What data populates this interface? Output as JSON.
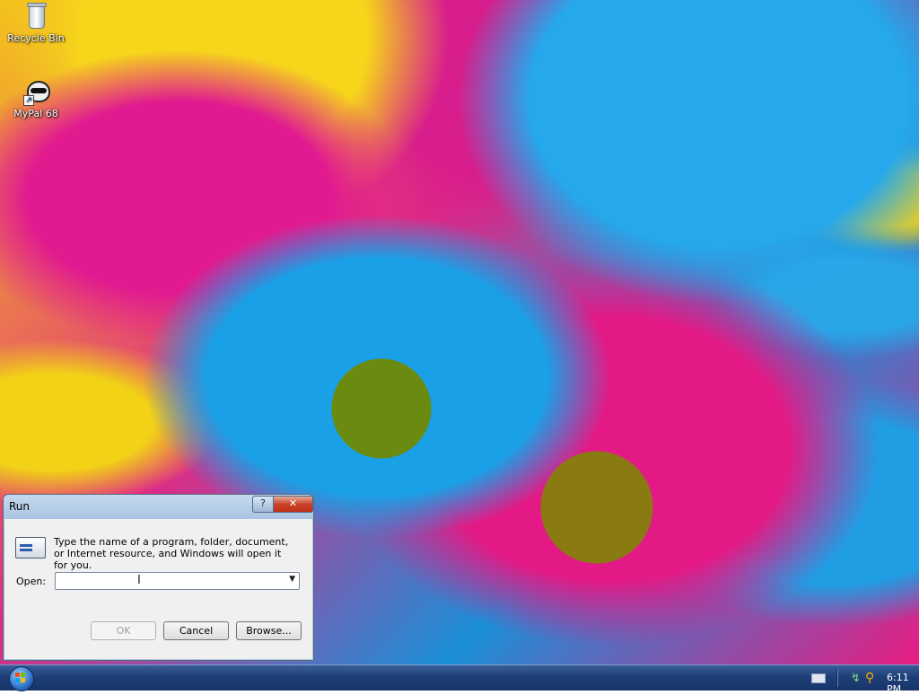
{
  "desktop": {
    "icons": [
      {
        "label": "Recycle Bin",
        "icon": "recycle-bin-icon"
      },
      {
        "label": "MyPal 68",
        "icon": "mypal-icon"
      }
    ]
  },
  "run_dialog": {
    "title": "Run",
    "help_label": "?",
    "close_label": "✕",
    "description": "Type the name of a program, folder, document, or Internet resource, and Windows will open it for you.",
    "open_label": "Open:",
    "open_value": "",
    "buttons": {
      "ok": "OK",
      "cancel": "Cancel",
      "browse": "Browse..."
    }
  },
  "taskbar": {
    "start_icon": "windows-start-orb",
    "tray_icons": [
      "keyboard-icon",
      "network-icon",
      "search-icon"
    ],
    "clock": "6:11 PM"
  }
}
